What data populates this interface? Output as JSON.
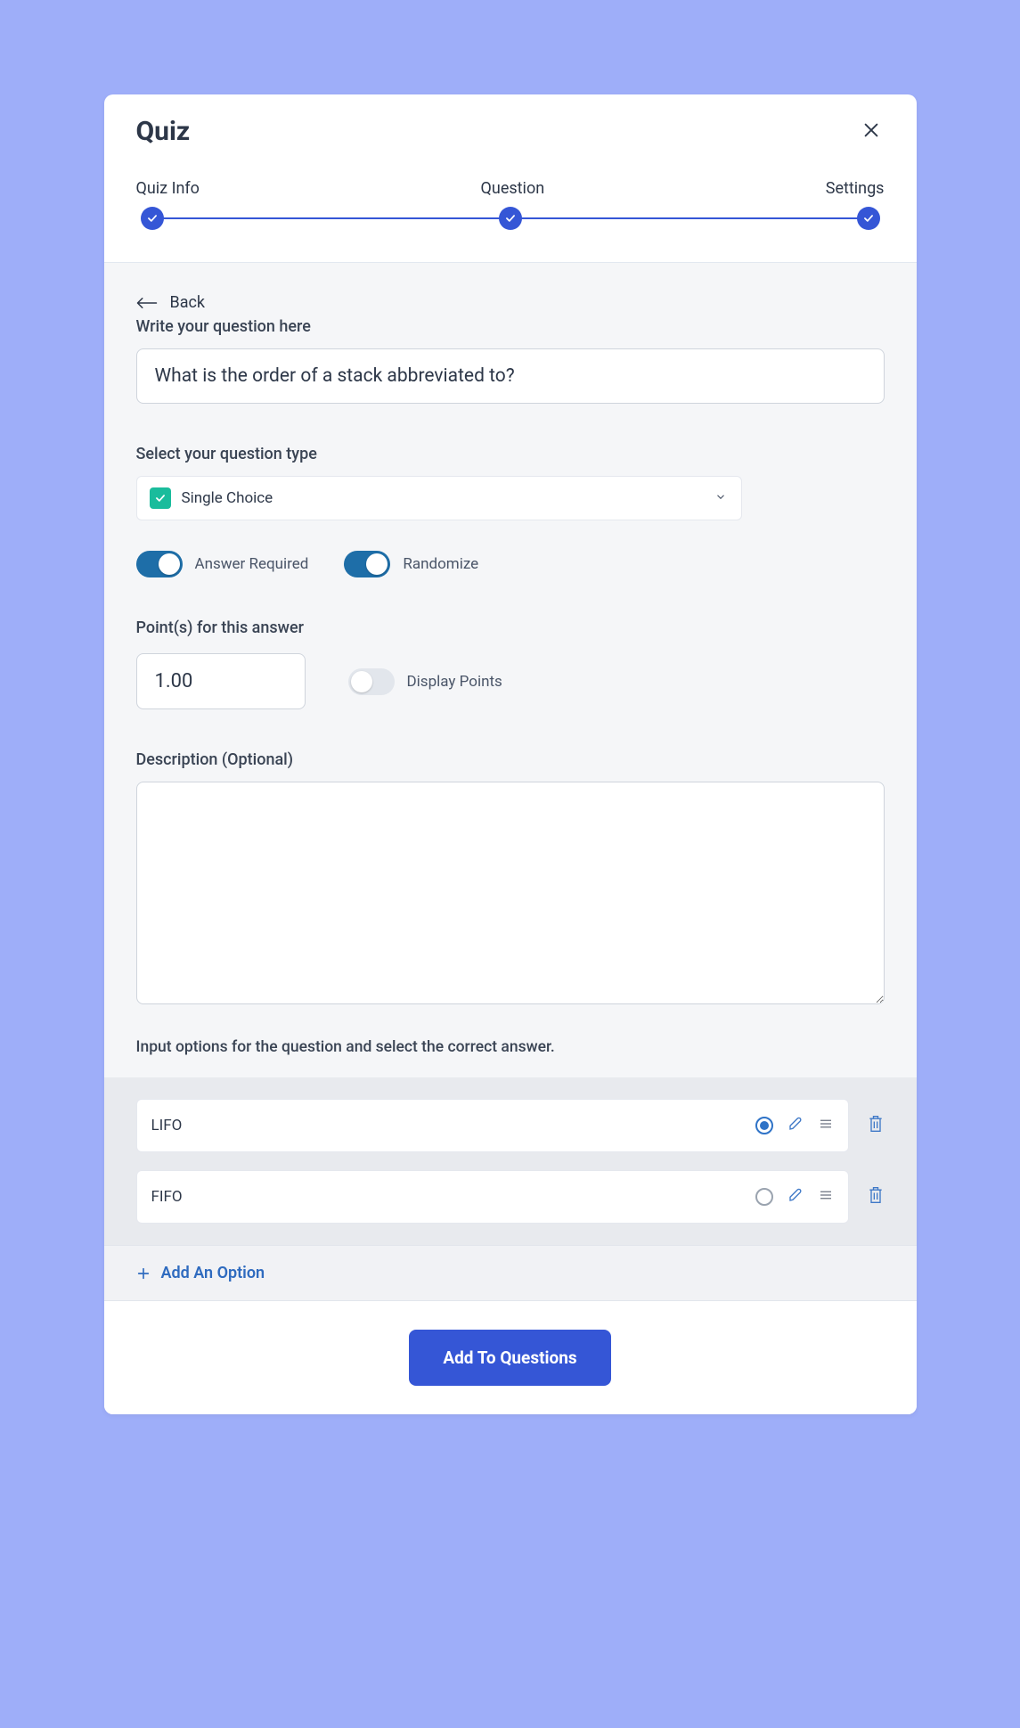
{
  "header": {
    "title": "Quiz"
  },
  "stepper": {
    "steps": [
      "Quiz Info",
      "Question",
      "Settings"
    ]
  },
  "back_label": "Back",
  "question": {
    "label": "Write your question here",
    "value": "What is the order of a stack abbreviated to?"
  },
  "type": {
    "label": "Select your question type",
    "selected": "Single Choice"
  },
  "toggles": {
    "answer_required": {
      "label": "Answer Required",
      "on": true
    },
    "randomize": {
      "label": "Randomize",
      "on": true
    },
    "display_points": {
      "label": "Display Points",
      "on": false
    }
  },
  "points": {
    "label": "Point(s) for this answer",
    "value": "1.00"
  },
  "description": {
    "label": "Description (Optional)",
    "value": ""
  },
  "options_hint": "Input options for the question and select the correct answer.",
  "options": [
    {
      "text": "LIFO",
      "correct": true
    },
    {
      "text": "FIFO",
      "correct": false
    }
  ],
  "add_option_label": "Add An Option",
  "submit_label": "Add To Questions"
}
